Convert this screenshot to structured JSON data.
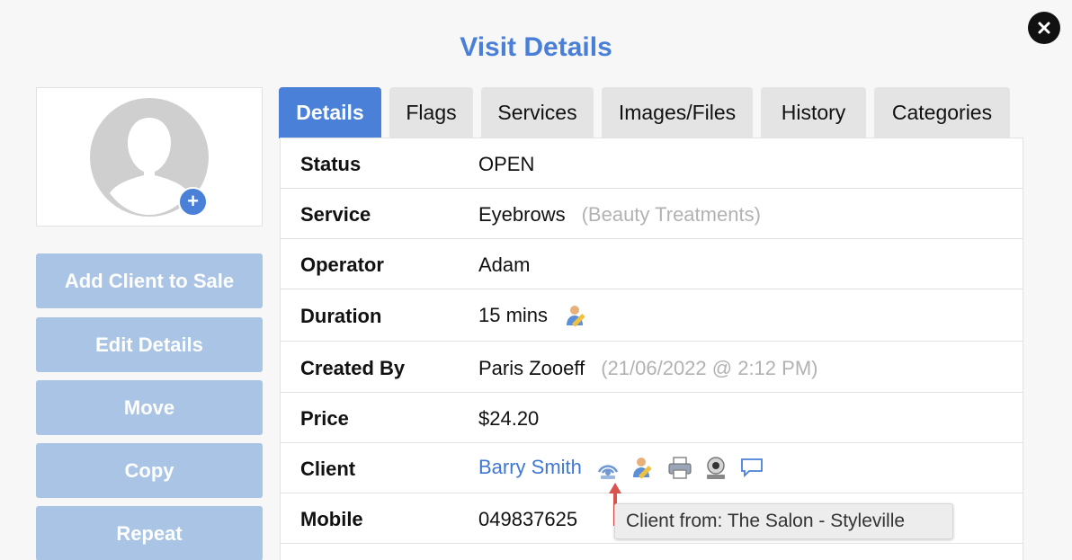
{
  "dialog": {
    "title": "Visit Details"
  },
  "sidebar": {
    "buttons": [
      {
        "label": "Add Client to Sale"
      },
      {
        "label": "Edit Details"
      },
      {
        "label": "Move"
      },
      {
        "label": "Copy"
      },
      {
        "label": "Repeat"
      }
    ]
  },
  "tabs": [
    {
      "label": "Details",
      "active": true
    },
    {
      "label": "Flags"
    },
    {
      "label": "Services"
    },
    {
      "label": "Images/Files"
    },
    {
      "label": "History"
    },
    {
      "label": "Categories"
    }
  ],
  "details": {
    "status": {
      "label": "Status",
      "value": "OPEN"
    },
    "service": {
      "label": "Service",
      "value": "Eyebrows",
      "category": "(Beauty Treatments)"
    },
    "operator": {
      "label": "Operator",
      "value": "Adam"
    },
    "duration": {
      "label": "Duration",
      "value": "15 mins",
      "icon": "edit-person-icon"
    },
    "created_by": {
      "label": "Created By",
      "value": "Paris Zooeff",
      "timestamp": "(21/06/2022 @ 2:12 PM)"
    },
    "price": {
      "label": "Price",
      "value": "$24.20"
    },
    "client": {
      "label": "Client",
      "value": "Barry Smith",
      "icons": [
        "network-client-icon",
        "edit-person-icon",
        "printer-icon",
        "webcam-icon",
        "chat-bubble-icon"
      ]
    },
    "mobile": {
      "label": "Mobile",
      "value": "049837625"
    }
  },
  "tooltip": {
    "text": "Client from: The Salon - Styleville"
  },
  "colors": {
    "accent": "#4a80d8",
    "button_disabled": "#a9c4e4",
    "title": "#4a7fd8",
    "link": "#3f78d2",
    "arrow": "#d9534f"
  }
}
